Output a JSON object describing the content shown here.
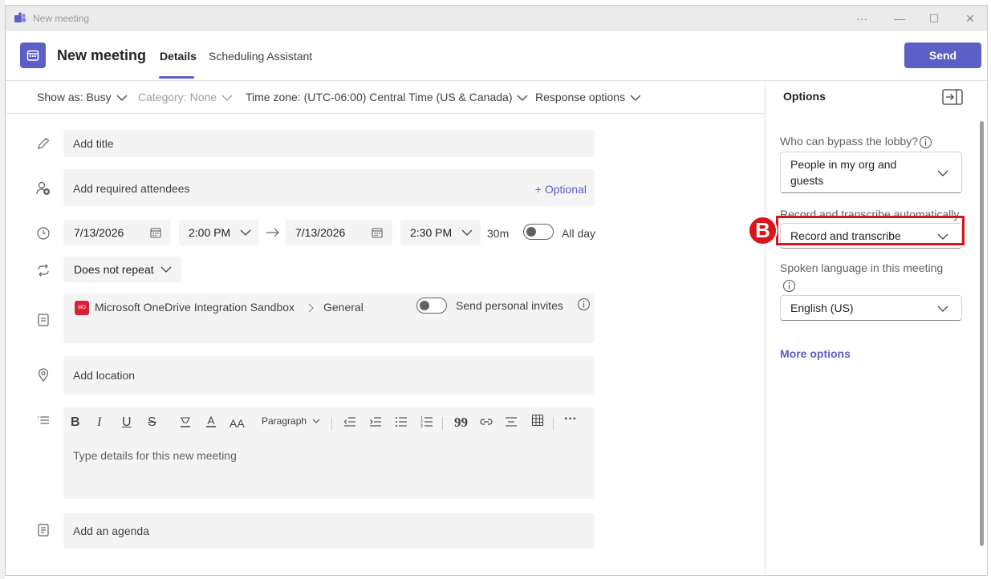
{
  "window": {
    "title": "New meeting",
    "controls": [
      "···",
      "—",
      "☐",
      "✕"
    ]
  },
  "header": {
    "title": "New meeting",
    "tabs": [
      {
        "label": "Details",
        "active": true
      },
      {
        "label": "Scheduling Assistant",
        "active": false
      }
    ],
    "send_label": "Send"
  },
  "optbar": {
    "show_as": "Show as: Busy",
    "category": "Category: None",
    "time_zone": "Time zone: (UTC-06:00) Central Time (US & Canada)",
    "response": "Response options"
  },
  "form": {
    "title_placeholder": "Add title",
    "attendees_placeholder": "Add required attendees",
    "optional_link": "+ Optional",
    "start_date": "7/13/2026",
    "start_time": "2:00 PM",
    "end_date": "7/13/2026",
    "end_time": "2:30 PM",
    "duration": "30m",
    "all_day": "All day",
    "repeat": "Does not repeat",
    "channel_badge": "MO",
    "channel_team": "Microsoft OneDrive Integration Sandbox",
    "channel_name": "General",
    "personal_invites": "Send personal invites",
    "location_placeholder": "Add location",
    "paragraph_label": "Paragraph",
    "details_placeholder": "Type details for this new meeting",
    "agenda_placeholder": "Add an agenda"
  },
  "options_pane": {
    "title": "Options",
    "lobby_label": "Who can bypass the lobby?",
    "lobby_value_line1": "People in my org and",
    "lobby_value_line2": "guests",
    "record_label": "Record and transcribe automatically",
    "record_value": "Record and transcribe",
    "language_label": "Spoken language in this meeting",
    "language_value": "English (US)",
    "more_options": "More options"
  },
  "annotation": {
    "marker_letter": "B",
    "color": "#d9141a"
  },
  "colors": {
    "accent": "#5b5fc7",
    "field_bg": "#f4f4f4"
  }
}
